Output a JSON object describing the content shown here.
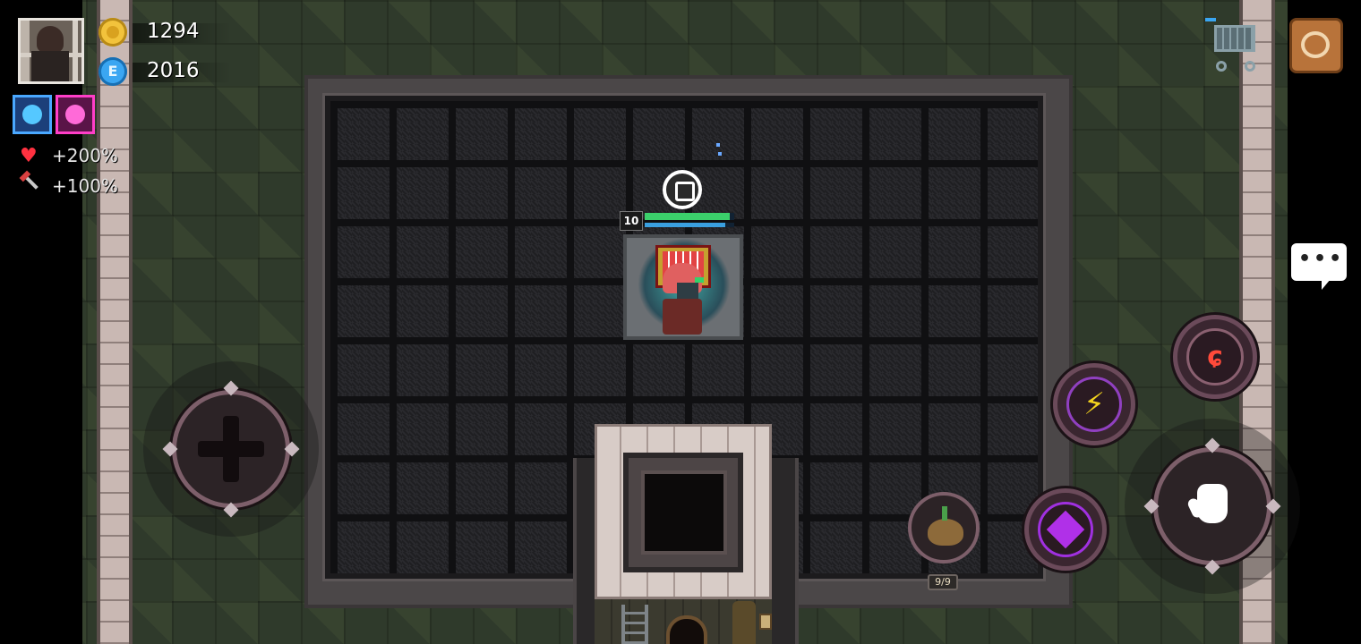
{
  "hud": {
    "coins": "1294",
    "gems": "2016",
    "gem_letter": "E",
    "hp_bonus": "+200%",
    "damage_bonus": "+100%"
  },
  "player": {
    "level": "10",
    "hp_fraction": 0.95,
    "energy_fraction": 0.9
  },
  "inventory": {
    "seed_count": "9/9"
  },
  "icons": {
    "coin": "gold-coin-icon",
    "gem": "energy-gem-icon",
    "heart": "heart-icon",
    "sword": "sword-icon",
    "shop": "shopping-cart-icon",
    "bag": "backpack-icon",
    "chat": "chat-bubble-icon",
    "skill_fire": "fire-rune-icon",
    "skill_lightning": "lightning-icon",
    "skill_void": "purple-eye-icon",
    "interact": "hand-icon",
    "move": "dpad-icon"
  },
  "colors": {
    "hp": "#3bd06b",
    "energy": "#3aa0e0",
    "fire": "#ff4a3a",
    "lightning": "#f2d21e",
    "void": "#b030e8"
  }
}
